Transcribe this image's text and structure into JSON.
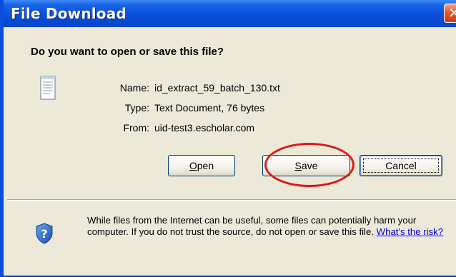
{
  "window": {
    "title": "File Download",
    "close_glyph": "✕"
  },
  "dialog": {
    "question": "Do you want to open or save this file?",
    "file_icon": "text-document-icon",
    "fields": {
      "name_label": "Name:",
      "name_value": "id_extract_59_batch_130.txt",
      "type_label": "Type:",
      "type_value": "Text Document, 76 bytes",
      "from_label": "From:",
      "from_value": "uid-test3.escholar.com"
    },
    "buttons": {
      "open_label": "Open",
      "open_mnemonic": "O",
      "open_rest": "pen",
      "save_label": "Save",
      "save_mnemonic": "S",
      "save_rest": "ave",
      "cancel_label": "Cancel"
    }
  },
  "security": {
    "icon": "shield-question-icon",
    "warning_text": "While files from the Internet can be useful, some files can potentially harm your computer. If you do not trust the source, do not open or save this file.",
    "risk_link": "What's the risk?"
  },
  "colors": {
    "titlebar": "#0a52dc",
    "dialog_bg": "#ece9d8",
    "highlight_circle": "#e01818",
    "link": "#0000ff"
  }
}
